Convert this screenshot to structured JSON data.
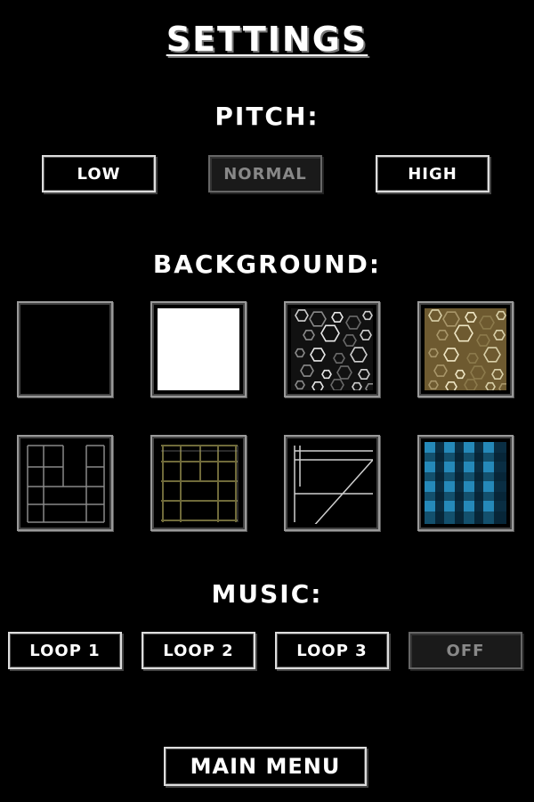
{
  "title": "SETTINGS",
  "pitch": {
    "heading": "PITCH:",
    "options": [
      "LOW",
      "NORMAL",
      "HIGH"
    ],
    "selected": "NORMAL"
  },
  "background": {
    "heading": "BACKGROUND:",
    "tiles": [
      "black",
      "white",
      "gray-hexagons",
      "gold-hexagons",
      "gray-grid",
      "olive-grid",
      "line-sketch",
      "blue-plaid"
    ]
  },
  "music": {
    "heading": "MUSIC:",
    "options": [
      "LOOP 1",
      "LOOP 2",
      "LOOP 3",
      "OFF"
    ],
    "selected": "OFF"
  },
  "main_menu_label": "MAIN MENU",
  "colors": {
    "background": "#000000",
    "text": "#ffffff",
    "selected_text": "#888888",
    "olive": "#6f6a3a",
    "gold": "#7a6a3a",
    "blue": "#2a9ad0"
  }
}
